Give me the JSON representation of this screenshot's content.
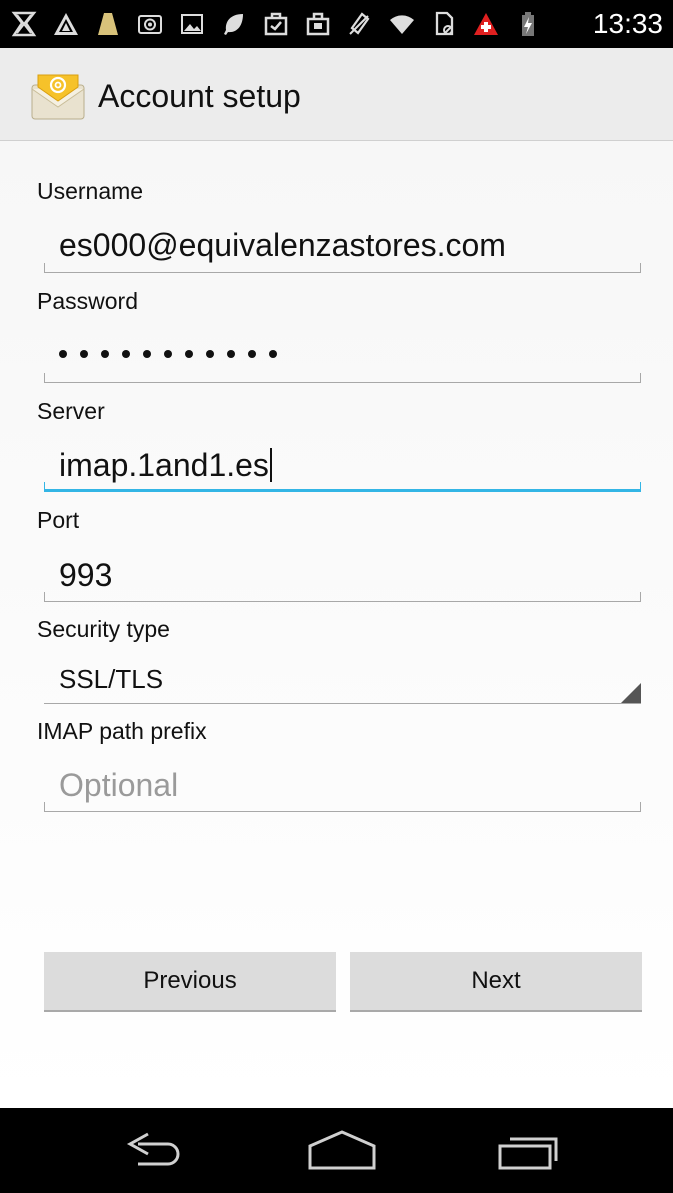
{
  "status_bar": {
    "time": "13:33",
    "icons": [
      "notification-x-icon",
      "warning-triangle-icon",
      "lamp-icon",
      "camera-icon",
      "image-icon",
      "leaf-icon",
      "clipboard-check-icon",
      "briefcase-icon",
      "no-sim-rotate-icon",
      "wifi-icon",
      "sd-card-icon",
      "red-cross-icon",
      "battery-charging-icon"
    ]
  },
  "action_bar": {
    "title": "Account setup",
    "icon": "email-app-icon"
  },
  "form": {
    "username": {
      "label": "Username",
      "value": "es000@equivalenzastores.com"
    },
    "password": {
      "label": "Password",
      "value_masked": "•••••••••••",
      "length": 11
    },
    "server": {
      "label": "Server",
      "value": "imap.1and1.es",
      "focused": true
    },
    "port": {
      "label": "Port",
      "value": "993"
    },
    "security_type": {
      "label": "Security type",
      "selected": "SSL/TLS"
    },
    "imap_path_prefix": {
      "label": "IMAP path prefix",
      "value": "",
      "placeholder": "Optional"
    }
  },
  "buttons": {
    "previous": "Previous",
    "next": "Next"
  },
  "nav_bar": {
    "icons": [
      "back-icon",
      "home-icon",
      "recent-apps-icon"
    ]
  },
  "colors": {
    "focus_accent": "#33b5e5",
    "status_bar_bg": "#000000",
    "action_bar_bg": "#ececec",
    "button_bg": "#dcdcdc"
  }
}
